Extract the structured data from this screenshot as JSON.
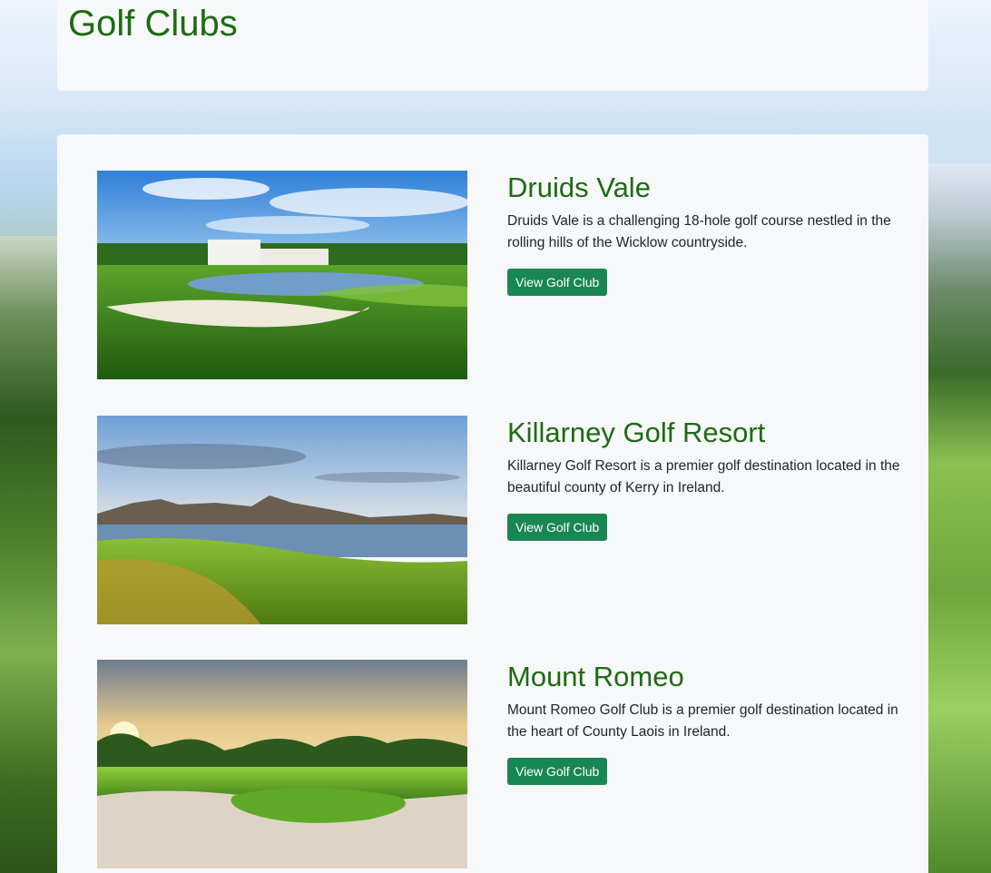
{
  "page": {
    "title": "Golf Clubs"
  },
  "clubs": [
    {
      "name": "Druids Vale",
      "description": "Druids Vale is a challenging 18-hole golf course nestled in the rolling hills of the Wicklow countryside.",
      "button_label": "View Golf Club"
    },
    {
      "name": "Killarney Golf Resort",
      "description": "Killarney Golf Resort is a premier golf destination located in the beautiful county of Kerry in Ireland.",
      "button_label": "View Golf Club"
    },
    {
      "name": "Mount Romeo",
      "description": "Mount Romeo Golf Club is a premier golf destination located in the heart of County Laois in Ireland.",
      "button_label": "View Golf Club"
    }
  ],
  "colors": {
    "heading": "#1e6b12",
    "button": "#198754",
    "panel": "#f7f8fa"
  }
}
